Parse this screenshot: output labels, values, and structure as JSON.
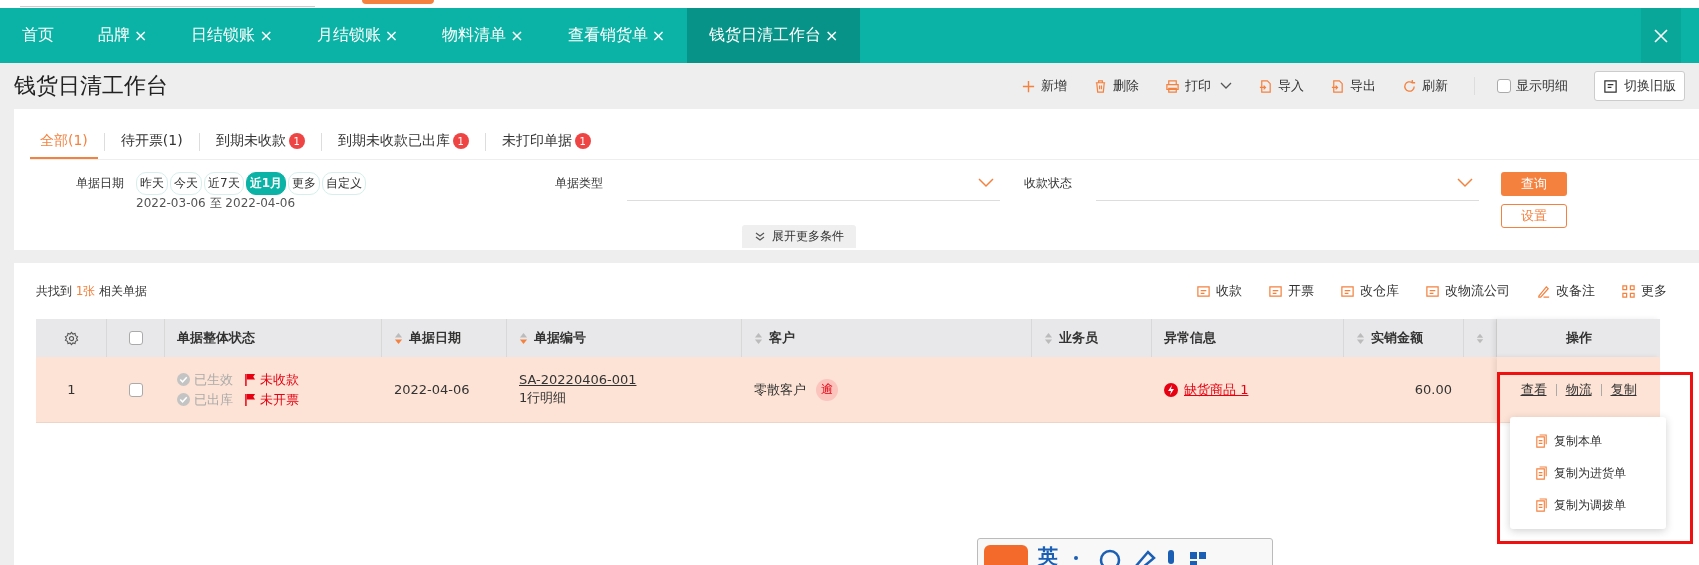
{
  "tabs": [
    {
      "label": "首页",
      "closable": false,
      "selected": false
    },
    {
      "label": "品牌",
      "closable": true,
      "selected": false
    },
    {
      "label": "日结锁账",
      "closable": true,
      "selected": false
    },
    {
      "label": "月结锁账",
      "closable": true,
      "selected": false
    },
    {
      "label": "物料清单",
      "closable": true,
      "selected": false
    },
    {
      "label": "查看销货单",
      "closable": true,
      "selected": false
    },
    {
      "label": "钱货日清工作台",
      "closable": true,
      "selected": true
    }
  ],
  "close_symbol": "×",
  "page_title": "钱货日清工作台",
  "toolbar": [
    {
      "label": "新增",
      "kind": "action"
    },
    {
      "label": "删除",
      "kind": "action"
    },
    {
      "label": "打印",
      "kind": "dropdown"
    },
    {
      "label": "导入",
      "kind": "action"
    },
    {
      "label": "导出",
      "kind": "action"
    },
    {
      "label": "刷新",
      "kind": "action"
    },
    {
      "label": "显示明细",
      "kind": "checkbox",
      "checked": false
    },
    {
      "label": "切换旧版",
      "kind": "button"
    }
  ],
  "filter_tabs": [
    {
      "label": "全部(1)",
      "selected": true
    },
    {
      "label": "待开票(1)",
      "selected": false
    },
    {
      "label": "到期未收款",
      "badge": "1",
      "selected": false
    },
    {
      "label": "到期未收款已出库",
      "badge": "1",
      "selected": false
    },
    {
      "label": "未打印单据",
      "badge": "1",
      "selected": false
    }
  ],
  "filters": {
    "date": {
      "label": "单据日期",
      "chips": [
        {
          "label": "昨天",
          "selected": false
        },
        {
          "label": "今天",
          "selected": false
        },
        {
          "label": "近7天",
          "selected": false
        },
        {
          "label": "近1月",
          "selected": true
        },
        {
          "label": "更多",
          "selected": false
        },
        {
          "label": "自定义",
          "selected": false
        }
      ],
      "range": "2022-03-06 至 2022-04-06"
    },
    "doc_type": {
      "label": "单据类型"
    },
    "payment_status": {
      "label": "收款状态"
    },
    "query_button": "查询",
    "settings_button": "设置",
    "expand": "展开更多条件"
  },
  "summary": {
    "prefix": "共找到",
    "count": "1张",
    "suffix": "相关单据"
  },
  "bulk_actions": [
    "收款",
    "开票",
    "改仓库",
    "改物流公司",
    "改备注",
    "更多"
  ],
  "table": {
    "columns": [
      {
        "label": "单据整体状态",
        "sortable": false
      },
      {
        "label": "单据日期",
        "sortable": true
      },
      {
        "label": "单据编号",
        "sortable": true
      },
      {
        "label": "客户",
        "sortable": true
      },
      {
        "label": "业务员",
        "sortable": true
      },
      {
        "label": "异常信息",
        "sortable": false
      },
      {
        "label": "实销金额",
        "sortable": true
      }
    ],
    "ops_column": "操作",
    "select_all_checked": false,
    "rows": [
      {
        "index": "1",
        "checked": false,
        "statuses": [
          "已生效",
          "已出库"
        ],
        "flags": [
          "未收款",
          "未开票"
        ],
        "date": "2022-04-06",
        "number": "SA-20220406-001",
        "detail": "1行明细",
        "customer": "零散客户",
        "customer_badge": "逾",
        "exception": "缺货商品 1",
        "amount": "60.00",
        "actions": [
          "查看",
          "物流",
          "复制"
        ]
      }
    ]
  },
  "copy_menu": [
    "复制本单",
    "复制为进货单",
    "复制为调拨单"
  ],
  "ime_toolbar": {
    "mode": "英"
  }
}
